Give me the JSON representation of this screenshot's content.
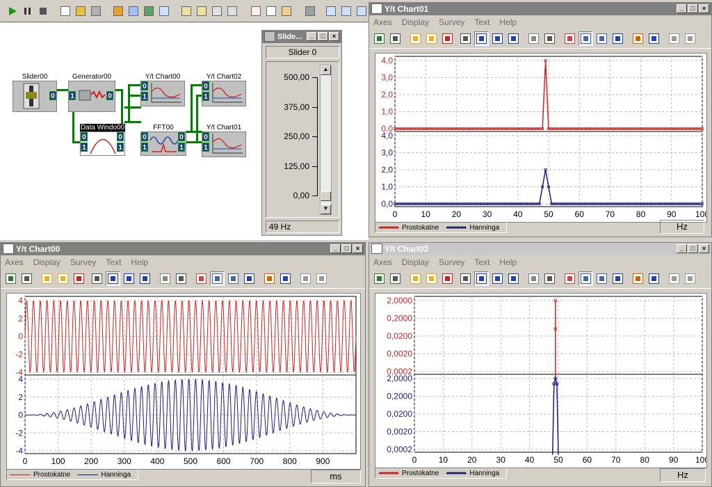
{
  "blocks": {
    "slider00": "Slider00",
    "generator00": "Generator00",
    "datawindow00": "Data Windo00",
    "fft00": "FFT00",
    "yt00": "Y/t Chart00",
    "yt01": "Y/t Chart01",
    "yt02": "Y/t Chart02",
    "port0": "0",
    "port1": "1"
  },
  "slider_window": {
    "title": "Slide...",
    "caption": "Slider 0",
    "ticks": [
      "500,00",
      "375,00",
      "250,00",
      "125,00",
      "0,00"
    ],
    "readout": "49 Hz",
    "value_fraction": 0.04
  },
  "menu": [
    "Axes",
    "Display",
    "Survey",
    "Text",
    "Help"
  ],
  "colors": {
    "red": "#cc2222",
    "blue": "#1a1a80"
  },
  "chart01": {
    "title": "Y/t Chart01",
    "unit": "Hz",
    "legend": [
      "Prostokatne",
      "Hanninga"
    ],
    "chart_data": {
      "type": "line",
      "x_ticks": [
        "0",
        "10",
        "20",
        "30",
        "40",
        "50",
        "60",
        "70",
        "80",
        "90",
        "100"
      ],
      "xlim": [
        0,
        100
      ],
      "upper_ticks": [
        "4,0",
        "3,0",
        "2,0",
        "1,0",
        "0,0"
      ],
      "lower_ticks": [
        "4,0",
        "3,0",
        "2,0",
        "1,0",
        "0,0"
      ],
      "ylim": [
        0,
        4.2
      ],
      "series": [
        {
          "name": "Prostokatne",
          "x": [
            0,
            48,
            49,
            50,
            100
          ],
          "values": [
            0,
            0,
            4,
            0,
            0
          ]
        },
        {
          "name": "Hanninga",
          "x": [
            0,
            47,
            48,
            49,
            50,
            51,
            100
          ],
          "values": [
            0,
            0,
            1.0,
            2.0,
            1.0,
            0,
            0
          ]
        }
      ]
    }
  },
  "chart00": {
    "title": "Y/t Chart00",
    "unit": "ms",
    "legend": [
      "Prostokatne",
      "Hanninga"
    ],
    "chart_data": {
      "type": "line",
      "x_ticks": [
        "0",
        "100",
        "200",
        "300",
        "400",
        "500",
        "600",
        "700",
        "800",
        "900"
      ],
      "xlim": [
        0,
        1000
      ],
      "upper_ticks": [
        "4",
        "2",
        "0",
        "-2",
        "-4"
      ],
      "lower_ticks": [
        "4",
        "2",
        "0",
        "-2",
        "-4"
      ],
      "ylim": [
        -4.5,
        4.5
      ],
      "frequency_hz": 49,
      "amplitude": 4
    }
  },
  "chart02": {
    "title": "Y/t Chart02",
    "unit": "Hz",
    "legend": [
      "Prostokatne",
      "Hanninga"
    ],
    "chart_data": {
      "type": "line",
      "x_ticks": [
        "0",
        "10",
        "20",
        "30",
        "40",
        "50",
        "60",
        "70",
        "80",
        "90",
        "100"
      ],
      "xlim": [
        0,
        100
      ],
      "upper_ticks": [
        "2,0000",
        "0,2000",
        "0,0200",
        "0,0020",
        "0,0002"
      ],
      "lower_ticks": [
        "2,0000",
        "0,2000",
        "0,0200",
        "0,0020",
        "0,0002"
      ],
      "y_scale": "log",
      "series": [
        {
          "name": "Prostokatne",
          "x": [
            49,
            49,
            49
          ],
          "values": [
            0.0001,
            0.05,
            2.0
          ]
        },
        {
          "name": "Hanninga",
          "x": [
            48,
            48.5,
            49,
            49.5,
            50
          ],
          "values": [
            0.0001,
            1.0,
            2.0,
            1.0,
            0.0001
          ]
        }
      ]
    }
  }
}
